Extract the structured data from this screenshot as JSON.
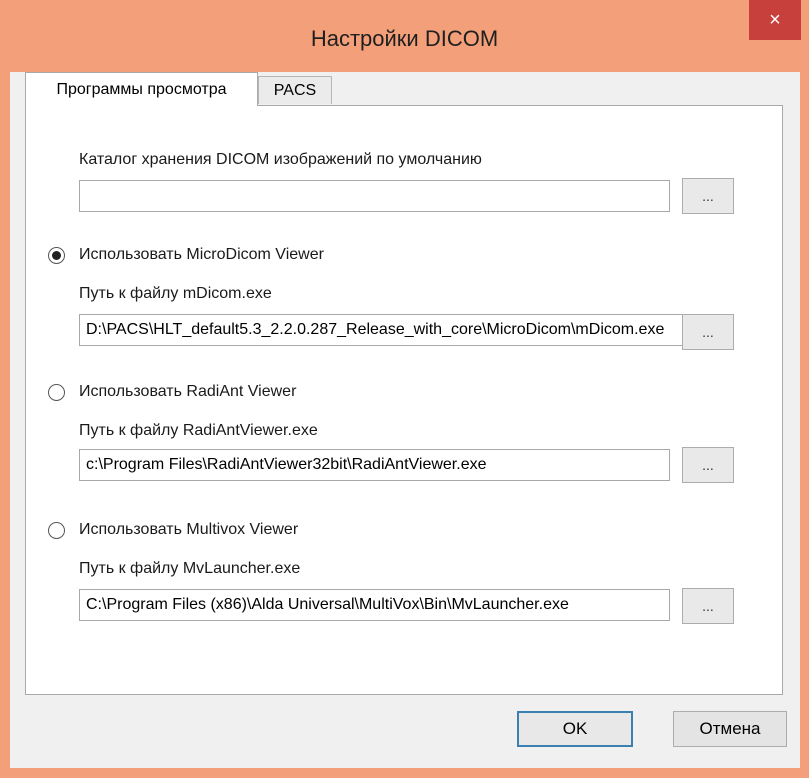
{
  "window": {
    "title": "Настройки DICOM",
    "close_label": "×"
  },
  "tabs": [
    {
      "label": "Программы просмотра",
      "active": true
    },
    {
      "label": "PACS",
      "active": false
    }
  ],
  "storage": {
    "label": "Каталог хранения DICOM изображений по умолчанию",
    "value": "",
    "browse_label": "..."
  },
  "viewers": [
    {
      "radio_label": "Использовать MicroDicom Viewer",
      "selected": true,
      "path_label": "Путь к файлу mDicom.exe",
      "path_value": "D:\\PACS\\HLT_default5.3_2.2.0.287_Release_with_core\\MicroDicom\\mDicom.exe",
      "browse_label": "..."
    },
    {
      "radio_label": "Использовать RadiAnt Viewer",
      "selected": false,
      "path_label": "Путь к файлу RadiAntViewer.exe",
      "path_value": "c:\\Program Files\\RadiAntViewer32bit\\RadiAntViewer.exe",
      "browse_label": "..."
    },
    {
      "radio_label": "Использовать Multivox Viewer",
      "selected": false,
      "path_label": "Путь к файлу MvLauncher.exe",
      "path_value": "C:\\Program Files (x86)\\Alda Universal\\MultiVox\\Bin\\MvLauncher.exe",
      "browse_label": "..."
    }
  ],
  "footer": {
    "ok_label": "OK",
    "cancel_label": "Отмена"
  },
  "colors": {
    "titlebar": "#f3a07a",
    "close": "#c7403b",
    "default_border": "#3c7fb1"
  }
}
